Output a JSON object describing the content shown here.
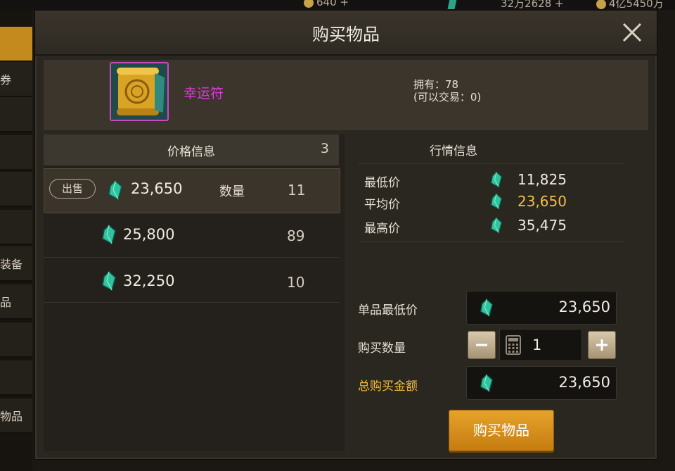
{
  "background": {
    "currencies": [
      {
        "value": "640"
      },
      {
        "value": "32万2628"
      },
      {
        "value": "4亿5450万"
      }
    ],
    "sidebar_tabs": [
      "",
      "券",
      "",
      "",
      "",
      "",
      "装备",
      "品",
      "",
      "",
      "物品"
    ]
  },
  "dialog": {
    "title": "购买物品",
    "close_icon": "close-icon"
  },
  "item": {
    "name": "幸运符",
    "owned": "拥有：78",
    "tradable": "(可以交易：0)",
    "name_color": "#e13ae0",
    "icon": "lucky-charm-scroll-icon"
  },
  "price_info": {
    "title": "价格信息",
    "count": "3",
    "sell_badge": "出售",
    "qty_label": "数量",
    "rows": [
      {
        "price": "23,650",
        "quantity": "11"
      },
      {
        "price": "25,800",
        "quantity": "89"
      },
      {
        "price": "32,250",
        "quantity": "10"
      }
    ]
  },
  "market": {
    "title": "行情信息",
    "rows": [
      {
        "label": "最低价",
        "value": "11,825"
      },
      {
        "label": "平均价",
        "value": "23,650"
      },
      {
        "label": "最高价",
        "value": "35,475"
      }
    ],
    "avg_color": "#f2c04a"
  },
  "purchase_form": {
    "min_price_label": "单品最低价",
    "min_price": "23,650",
    "quantity_label": "购买数量",
    "quantity": "1",
    "total_label": "总购买金额",
    "total": "23,650",
    "buy_button": "购买物品",
    "accent_color": "#e6a32a"
  }
}
